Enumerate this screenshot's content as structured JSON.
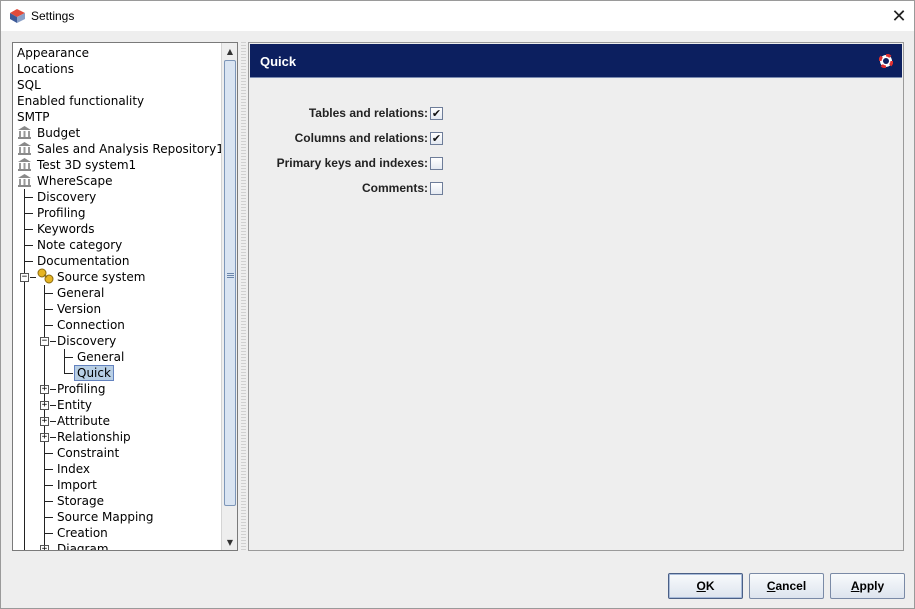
{
  "window": {
    "title": "Settings"
  },
  "tree": {
    "items": [
      {
        "label": "Appearance"
      },
      {
        "label": "Locations"
      },
      {
        "label": "SQL"
      },
      {
        "label": "Enabled functionality"
      },
      {
        "label": "SMTP"
      },
      {
        "label": "Budget"
      },
      {
        "label": "Sales and Analysis Repository1"
      },
      {
        "label": "Test 3D system1"
      },
      {
        "label": "WhereScape"
      },
      {
        "label": "Discovery"
      },
      {
        "label": "Profiling"
      },
      {
        "label": "Keywords"
      },
      {
        "label": "Note category"
      },
      {
        "label": "Documentation"
      },
      {
        "label": "Source system"
      },
      {
        "label": "General"
      },
      {
        "label": "Version"
      },
      {
        "label": "Connection"
      },
      {
        "label": "Discovery"
      },
      {
        "label": "General"
      },
      {
        "label": "Quick"
      },
      {
        "label": "Profiling"
      },
      {
        "label": "Entity"
      },
      {
        "label": "Attribute"
      },
      {
        "label": "Relationship"
      },
      {
        "label": "Constraint"
      },
      {
        "label": "Index"
      },
      {
        "label": "Import"
      },
      {
        "label": "Storage"
      },
      {
        "label": "Source Mapping"
      },
      {
        "label": "Creation"
      },
      {
        "label": "Diagram"
      }
    ],
    "selected": "Quick"
  },
  "panel": {
    "title": "Quick",
    "options": [
      {
        "label": "Tables and relations:",
        "checked": true,
        "mark": "✔"
      },
      {
        "label": "Columns and relations:",
        "checked": true,
        "mark": "✔"
      },
      {
        "label": "Primary keys and indexes:",
        "checked": false,
        "mark": ""
      },
      {
        "label": "Comments:",
        "checked": false,
        "mark": ""
      }
    ]
  },
  "buttons": {
    "ok_mnemonic": "O",
    "ok_rest": "K",
    "cancel_mnemonic": "C",
    "cancel_rest": "ancel",
    "apply_mnemonic": "A",
    "apply_rest": "pply"
  },
  "colors": {
    "header": "#0c1f5f",
    "selection": "#b8cfe5"
  },
  "icons": {
    "app": "settings-app-icon",
    "close": "close-icon",
    "bank": "bank-icon",
    "source_system": "source-system-icon",
    "help": "lifebuoy-icon"
  }
}
